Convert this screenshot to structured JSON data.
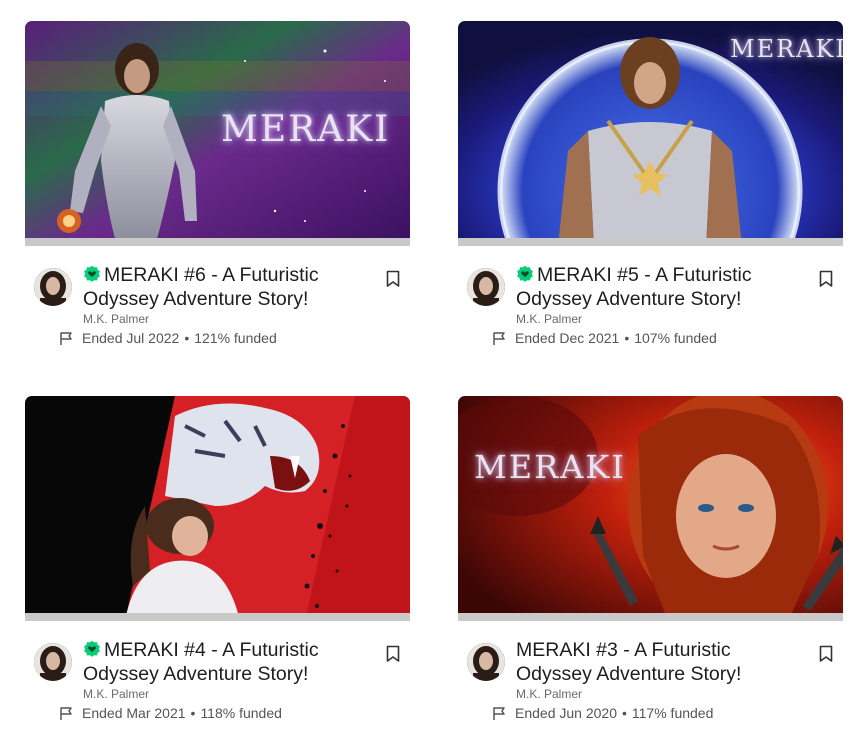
{
  "cards": [
    {
      "title": "MERAKI #6 - A Futuristic Odyssey Adventure Story!",
      "projects_we_love": true,
      "creator": "M.K. Palmer",
      "status": "Ended Jul 2022",
      "funded": "121% funded",
      "logo_text": "MERAKI",
      "bookmark": true
    },
    {
      "title": "MERAKI #5 - A Futuristic Odyssey Adventure Story!",
      "projects_we_love": true,
      "creator": "M.K. Palmer",
      "status": "Ended Dec 2021",
      "funded": "107% funded",
      "logo_text": "MERAKI",
      "bookmark": true
    },
    {
      "title": "MERAKI #4 - A Futuristic Odyssey Adventure Story!",
      "projects_we_love": true,
      "creator": "M.K. Palmer",
      "status": "Ended Mar 2021",
      "funded": "118% funded",
      "logo_text": "",
      "bookmark": true
    },
    {
      "title": "MERAKI #3 - A Futuristic Odyssey Adventure Story!",
      "projects_we_love": false,
      "creator": "M.K. Palmer",
      "status": "Ended Jun 2020",
      "funded": "117% funded",
      "logo_text": "MERAKI",
      "bookmark": true
    }
  ],
  "icons": {
    "badge": "projects-we-love-icon",
    "flag": "flag-icon",
    "bookmark": "bookmark-icon"
  },
  "colors": {
    "badge_green": "#05ce78",
    "progress_gray": "#c9c9c9",
    "text_dark": "#1e1e1e",
    "text_muted": "#6a6a6a"
  }
}
